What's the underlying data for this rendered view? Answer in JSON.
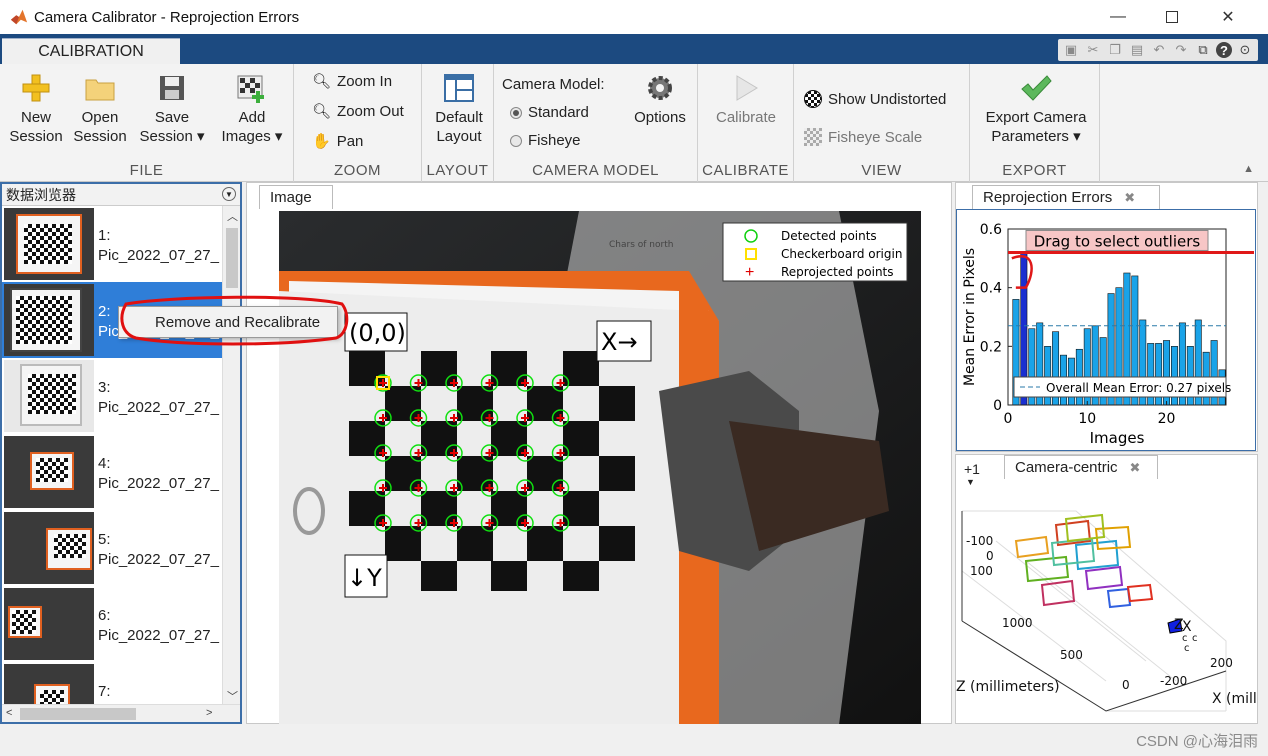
{
  "window": {
    "title": "Camera Calibrator - Reprojection Errors"
  },
  "ribbon": {
    "tab": "CALIBRATION",
    "file": {
      "label": "FILE",
      "new_session": [
        "New",
        "Session"
      ],
      "open_session": [
        "Open",
        "Session"
      ],
      "save_session": [
        "Save",
        "Session ▾"
      ],
      "add_images": [
        "Add",
        "Images ▾"
      ]
    },
    "zoom": {
      "label": "ZOOM",
      "zoom_in": "Zoom In",
      "zoom_out": "Zoom Out",
      "pan": "Pan"
    },
    "layout": {
      "label": "LAYOUT",
      "default_layout": [
        "Default",
        "Layout"
      ]
    },
    "camera_model": {
      "label": "CAMERA MODEL",
      "title": "Camera Model:",
      "standard": "Standard",
      "fisheye": "Fisheye",
      "options": "Options",
      "selected": "Standard"
    },
    "calibrate": {
      "label": "CALIBRATE",
      "calibrate": "Calibrate"
    },
    "view": {
      "label": "VIEW",
      "show_undistorted": "Show Undistorted",
      "fisheye_scale": "Fisheye Scale"
    },
    "export": {
      "label": "EXPORT",
      "export_params": [
        "Export Camera",
        "Parameters ▾"
      ]
    }
  },
  "browser": {
    "title": "数据浏览器",
    "items": [
      {
        "num": "1:",
        "name": "Pic_2022_07_27_"
      },
      {
        "num": "2:",
        "name": "Pic_2022_07_27_"
      },
      {
        "num": "3:",
        "name": "Pic_2022_07_27_"
      },
      {
        "num": "4:",
        "name": "Pic_2022_07_27_"
      },
      {
        "num": "5:",
        "name": "Pic_2022_07_27_"
      },
      {
        "num": "6:",
        "name": "Pic_2022_07_27_"
      },
      {
        "num": "7:",
        "name": ""
      }
    ],
    "selected_index": 2
  },
  "context_menu": {
    "item": "Remove and Recalibrate"
  },
  "image_panel": {
    "tab": "Image",
    "legend": [
      "Detected points",
      "Checkerboard origin",
      "Reprojected points"
    ],
    "origin_label": "(0,0)",
    "x_label": "X→",
    "y_label": "↓Y",
    "board_shirt_text": "Chars of north"
  },
  "reprojection": {
    "tab": "Reprojection Errors",
    "drag_hint": "Drag to select outliers",
    "overall_label": "Overall Mean Error: 0.27 pixels",
    "colors": {
      "bar": "#1aa3e8",
      "selected": "#1a2fd0",
      "threshold": "#e01818"
    }
  },
  "camera_centric": {
    "tab": "Camera-centric",
    "plus_label": "+1",
    "y_ticks": [
      "-100",
      "0",
      "100"
    ],
    "z_ticks": [
      "1000",
      "500",
      "0"
    ],
    "x_ticks": [
      "200",
      "-200"
    ],
    "z_label": "Z (millimeters)",
    "x_label": "X (mill",
    "axis_letters": [
      "Z",
      "X",
      "c",
      "c",
      "c"
    ]
  },
  "status": {
    "watermark": "CSDN @心海泪雨"
  },
  "chart_data": {
    "type": "bar",
    "xlabel": "Images",
    "ylabel": "Mean Error in Pixels",
    "ylim": [
      0,
      0.6
    ],
    "xticks": [
      0,
      10,
      20
    ],
    "yticks": [
      0,
      0.2,
      0.4,
      0.6
    ],
    "grid": false,
    "overall_mean": 0.27,
    "threshold": 0.52,
    "selected_index": 2,
    "categories": [
      1,
      2,
      3,
      4,
      5,
      6,
      7,
      8,
      9,
      10,
      11,
      12,
      13,
      14,
      15,
      16,
      17,
      18,
      19,
      20,
      21,
      22,
      23,
      24,
      25,
      26,
      27
    ],
    "values": [
      0.36,
      0.52,
      0.26,
      0.28,
      0.2,
      0.25,
      0.17,
      0.16,
      0.19,
      0.26,
      0.27,
      0.23,
      0.38,
      0.4,
      0.45,
      0.44,
      0.29,
      0.21,
      0.21,
      0.22,
      0.2,
      0.28,
      0.2,
      0.29,
      0.18,
      0.22,
      0.12
    ]
  }
}
